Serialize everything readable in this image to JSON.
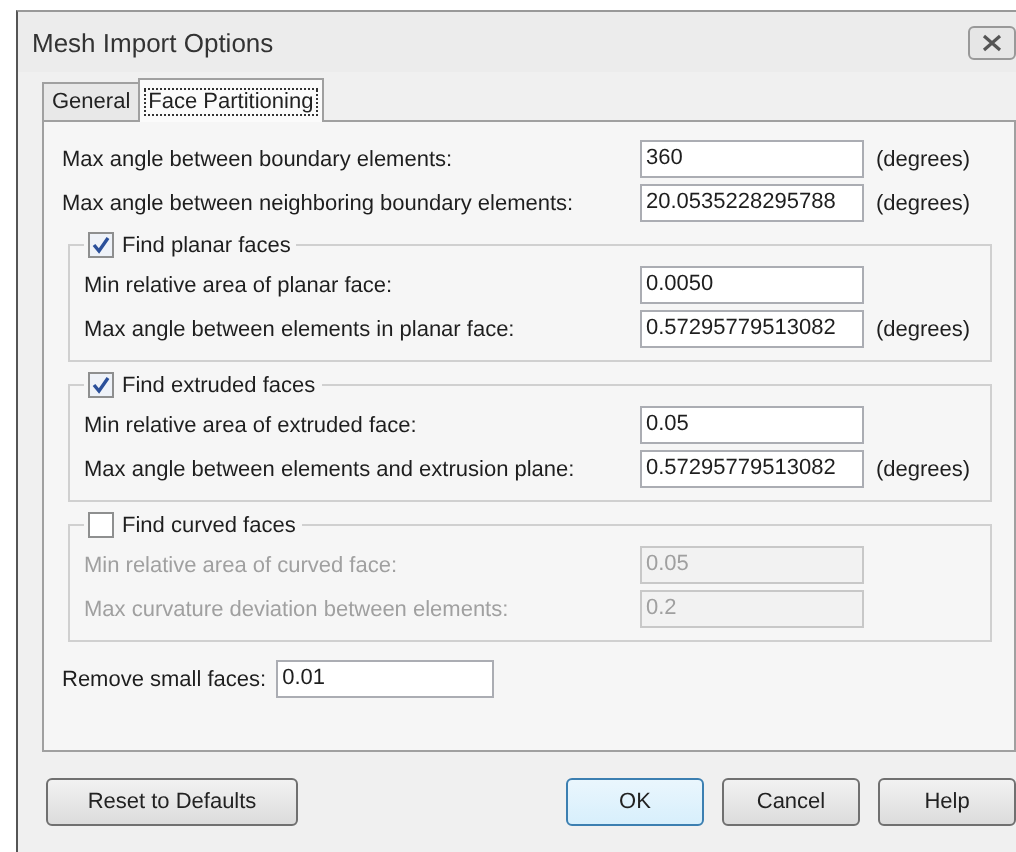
{
  "window": {
    "title": "Mesh Import Options"
  },
  "tabs": [
    {
      "label": "General",
      "selected": false
    },
    {
      "label": "Face Partitioning",
      "selected": true
    }
  ],
  "fields": [
    {
      "label": "Max angle between boundary elements:",
      "value": "360",
      "unit": "(degrees)"
    },
    {
      "label": "Max angle between neighboring boundary elements:",
      "value": "20.0535228295788",
      "unit": "(degrees)"
    }
  ],
  "groups": [
    {
      "title": "Find planar faces",
      "checked": true,
      "fields": [
        {
          "label": "Min relative area of planar face:",
          "value": "0.0050"
        },
        {
          "label": "Max angle between elements in planar face:",
          "value": "0.57295779513082",
          "unit": "(degrees)"
        }
      ]
    },
    {
      "title": "Find extruded faces",
      "checked": true,
      "fields": [
        {
          "label": "Min relative area of extruded face:",
          "value": "0.05"
        },
        {
          "label": "Max angle between elements and extrusion plane:",
          "value": "0.57295779513082",
          "unit": "(degrees)"
        }
      ]
    },
    {
      "title": "Find curved faces",
      "checked": false,
      "fields": [
        {
          "label": "Min relative area of curved face:",
          "value": "0.05"
        },
        {
          "label": "Max curvature deviation between elements:",
          "value": "0.2"
        }
      ]
    }
  ],
  "remove_small_faces": {
    "label": "Remove small faces:",
    "value": "0.01"
  },
  "buttons": [
    {
      "label": "Reset to Defaults",
      "kind": "left",
      "default": false
    },
    {
      "label": "OK",
      "kind": "right",
      "default": true
    },
    {
      "label": "Cancel",
      "kind": "right",
      "default": false
    },
    {
      "label": "Help",
      "kind": "right",
      "default": false
    }
  ]
}
